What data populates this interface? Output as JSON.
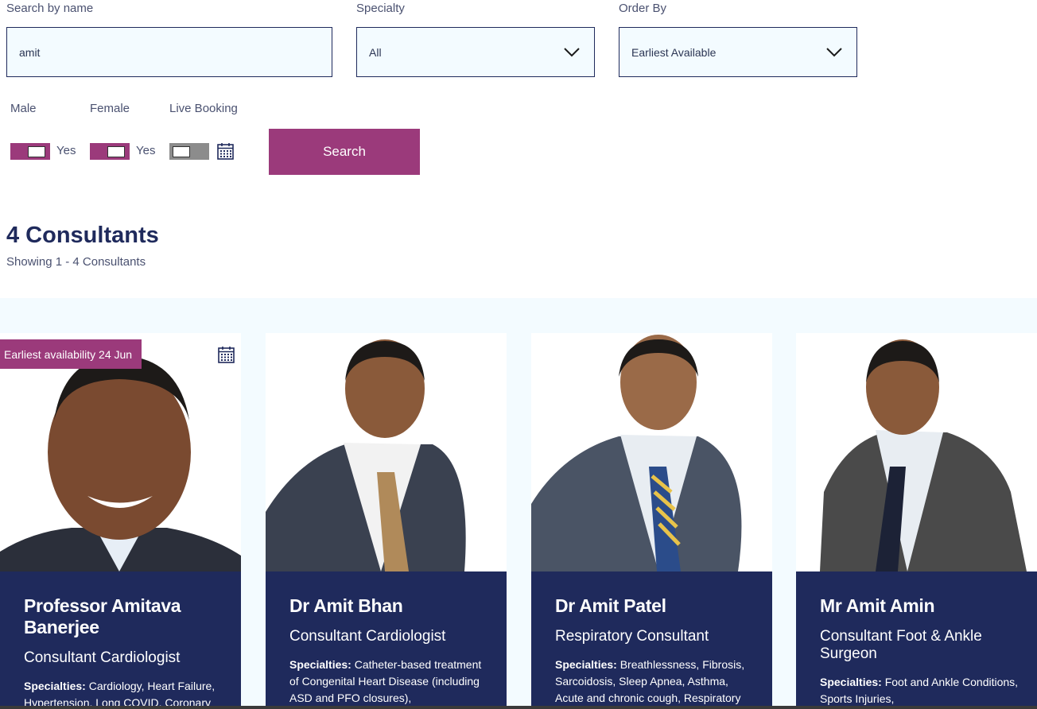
{
  "filters": {
    "search_label": "Search by name",
    "search_value": "amit",
    "specialty_label": "Specialty",
    "specialty_value": "All",
    "order_label": "Order By",
    "order_value": "Earliest Available",
    "male_label": "Male",
    "male_value": "Yes",
    "female_label": "Female",
    "female_value": "Yes",
    "live_label": "Live Booking",
    "search_button": "Search",
    "icons": {
      "dropdown": "chevron-down-icon",
      "calendar": "calendar-icon"
    },
    "toggle_states": {
      "male": true,
      "female": true,
      "live_booking": false
    }
  },
  "results": {
    "title": "4 Consultants",
    "subtitle": "Showing 1 - 4 Consultants"
  },
  "consultants": [
    {
      "name": "Professor Amitava Banerjee",
      "role": "Consultant Cardiologist",
      "specialties_label": "Specialties:",
      "specialties": "Cardiology, Heart Failure, Hypertension, Long COVID, Coronary",
      "badge": "Earliest availability 24 Jun",
      "icon": "calendar-icon"
    },
    {
      "name": "Dr Amit Bhan",
      "role": "Consultant Cardiologist",
      "specialties_label": "Specialties:",
      "specialties": "Catheter-based treatment of Congenital Heart Disease (including ASD and PFO closures),"
    },
    {
      "name": "Dr Amit Patel",
      "role": "Respiratory Consultant",
      "specialties_label": "Specialties:",
      "specialties": "Breathlessness, Fibrosis, Sarcoidosis, Sleep Apnea, Asthma, Acute and chronic cough, Respiratory"
    },
    {
      "name": "Mr Amit Amin",
      "role": "Consultant Foot & Ankle Surgeon",
      "specialties_label": "Specialties:",
      "specialties": "Foot and Ankle Conditions, Sports Injuries,"
    }
  ],
  "colors": {
    "accent": "#9b3a7b",
    "navy": "#1f2a5c",
    "input_bg": "#f3fbff",
    "toggle_off": "#8c8c8c"
  }
}
